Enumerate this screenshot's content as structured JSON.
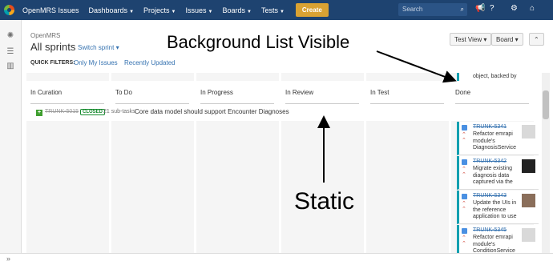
{
  "topbar": {
    "brand": "OpenMRS Issues",
    "nav": [
      {
        "label": "Dashboards"
      },
      {
        "label": "Projects"
      },
      {
        "label": "Issues"
      },
      {
        "label": "Boards"
      },
      {
        "label": "Tests"
      }
    ],
    "create_label": "Create",
    "search_placeholder": "Search",
    "colors": {
      "bar": "#1e4370",
      "create": "#d9a233"
    }
  },
  "header": {
    "project": "OpenMRS",
    "title": "All sprints",
    "switch_label": "Switch sprint",
    "quick_filters_label": "QUICK FILTERS:",
    "quick_filters": [
      "Only My Issues",
      "Recently Updated"
    ],
    "view_button": "Test View",
    "board_button": "Board"
  },
  "columns": [
    "In Curation",
    "To Do",
    "In Progress",
    "In Review",
    "In Test",
    "Done"
  ],
  "background_card_text": "object, backed by",
  "swimlane": {
    "key": "TRUNK-5015",
    "status": "CLOSED",
    "subtasks": "21 sub-tasks",
    "summary": "Core data model should support Encounter Diagnoses"
  },
  "cards": [
    {
      "key": "TRUNK-5341",
      "summary": "Refactor emrapi module's DiagnosisService"
    },
    {
      "key": "TRUNK-5342",
      "summary": "Migrate existing diagnosis data captured via the"
    },
    {
      "key": "TRUNK-5343",
      "summary": "Update the UIs in the reference application to use"
    },
    {
      "key": "TRUNK-5345",
      "summary": "Refactor emrapi module's ConditionService"
    }
  ],
  "annotations": {
    "background": "Background List Visible",
    "static": "Static"
  }
}
